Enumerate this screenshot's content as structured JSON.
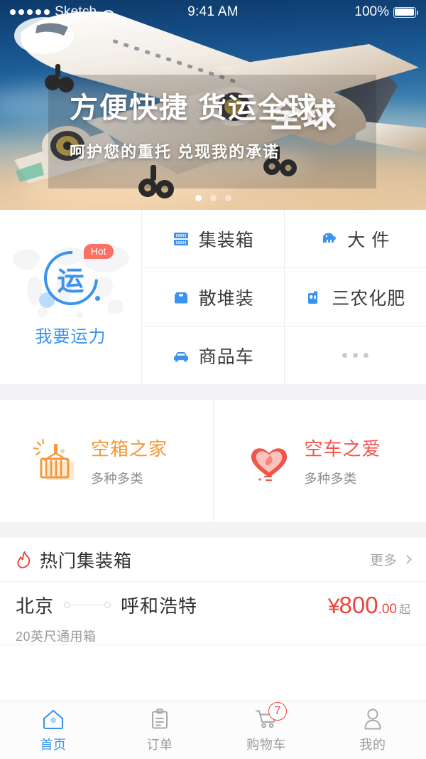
{
  "statusbar": {
    "carrier": "Sketch",
    "time": "9:41 AM",
    "battery": "100%",
    "signal_icon": "signal-dots-icon",
    "wifi_icon": "wifi-icon",
    "battery_icon": "battery-full-icon"
  },
  "hero": {
    "title": "方便快捷 货运全球",
    "subtitle": "呵护您的重托  兑现我的承诺",
    "ghost_text": "全球",
    "image_alt": "cargo-airplane-photo",
    "carousel": {
      "total": 3,
      "active_index": 0
    }
  },
  "quick_entry": {
    "char": "运",
    "badge": "Hot",
    "label": "我要运力",
    "icon": "transport-ring-icon",
    "accent": "#3b93f0",
    "badge_color": "#fb7063"
  },
  "categories": [
    {
      "label": "集装箱",
      "icon": "container-icon"
    },
    {
      "label": "大 件",
      "icon": "elephant-icon"
    },
    {
      "label": "散堆装",
      "icon": "bulk-box-icon"
    },
    {
      "label": "三农化肥",
      "icon": "fertilizer-jug-icon"
    },
    {
      "label": "商品车",
      "icon": "car-icon"
    },
    {
      "label": "",
      "icon": "more-dots-icon"
    }
  ],
  "promos": [
    {
      "title": "空箱之家",
      "subtitle": "多种多类",
      "icon": "container-crane-icon",
      "color": "#f59637"
    },
    {
      "title": "空车之爱",
      "subtitle": "多种多类",
      "icon": "heart-icon",
      "color": "#f1544b"
    }
  ],
  "hot_section": {
    "title": "热门集装箱",
    "icon": "flame-icon",
    "more_label": "更多",
    "more_icon": "chevron-right-icon",
    "routes": [
      {
        "origin": "北京",
        "destination": "呼和浩特",
        "spec": "20英尺通用箱",
        "currency": "¥",
        "price_integer": "800",
        "price_decimal": ".00",
        "price_suffix": "起",
        "price_color": "#e8453c"
      }
    ]
  },
  "tabbar": {
    "items": [
      {
        "label": "首页",
        "icon": "home-icon",
        "active": true,
        "badge": ""
      },
      {
        "label": "订单",
        "icon": "clipboard-icon",
        "active": false,
        "badge": ""
      },
      {
        "label": "购物车",
        "icon": "cart-icon",
        "active": false,
        "badge": "7"
      },
      {
        "label": "我的",
        "icon": "user-icon",
        "active": false,
        "badge": ""
      }
    ],
    "active_color": "#3b93f0",
    "inactive_color": "#9a9aa0"
  }
}
